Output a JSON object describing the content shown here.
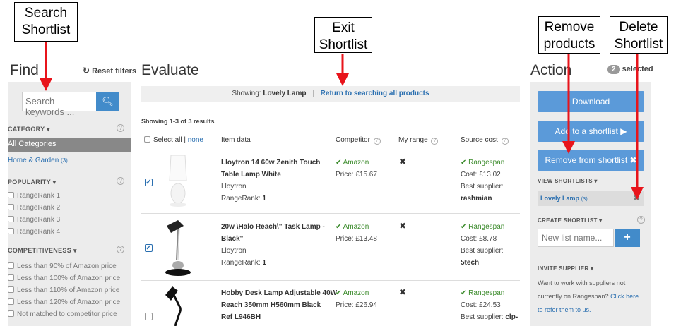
{
  "callouts": {
    "search": [
      "Search",
      "Shortlist"
    ],
    "exit": [
      "Exit",
      "Shortlist"
    ],
    "remove": [
      "Remove",
      "products"
    ],
    "delete": [
      "Delete",
      "Shortlist"
    ],
    "arrow_color": "#e8141b"
  },
  "find": {
    "heading": "Find",
    "reset_label": "Reset filters",
    "search_placeholder": "Search keywords ...",
    "category_title": "CATEGORY",
    "all_categories": "All Categories",
    "home_garden": "Home & Garden",
    "home_garden_count": "(3)",
    "popularity_title": "POPULARITY",
    "popularity": [
      "RangeRank 1",
      "RangeRank 2",
      "RangeRank 3",
      "RangeRank 4"
    ],
    "competitiveness_title": "COMPETITIVENESS",
    "competitiveness": [
      "Less than 90% of Amazon price",
      "Less than 100% of Amazon price",
      "Less than 110% of Amazon price",
      "Less than 120% of Amazon price",
      "Not matched to competitor price"
    ]
  },
  "evaluate": {
    "heading": "Evaluate",
    "showing_label": "Showing:",
    "showing_value": "Lovely Lamp",
    "return_link": "Return to searching all products",
    "results_count": "Showing 1-3 of 3 results",
    "select_all": "Select all",
    "none": "none",
    "columns": [
      "Item data",
      "Competitor",
      "My range",
      "Source cost"
    ],
    "rows": [
      {
        "title_1": "Lloytron 14 60w Zenith Touch",
        "title_2": "Table Lamp White",
        "brand": "Lloytron",
        "rank_label": "RangeRank:",
        "rank": "1",
        "competitor": "Amazon",
        "price": "Price: £15.67",
        "my_range": "✖",
        "source": "Rangespan",
        "cost": "Cost: £13.02",
        "supplier_label": "Best supplier:",
        "supplier": "rashmian",
        "checked": true
      },
      {
        "title_1": "20w \\Halo Reach\\\" Task Lamp -",
        "title_2": "Black\"",
        "brand": "Lloytron",
        "rank_label": "RangeRank:",
        "rank": "1",
        "competitor": "Amazon",
        "price": "Price: £13.48",
        "my_range": "✖",
        "source": "Rangespan",
        "cost": "Cost: £8.78",
        "supplier_label": "Best supplier:",
        "supplier": "5tech",
        "checked": true
      },
      {
        "title_1": "Hobby Desk Lamp Adjustable 40W",
        "title_2": "Reach 350mm H560mm Black",
        "title_3": "Ref L946BH",
        "competitor": "Amazon",
        "price": "Price: £26.94",
        "my_range": "✖",
        "source": "Rangespan",
        "cost": "Cost: £24.53",
        "supplier_label": "Best supplier:",
        "supplier": "clp-",
        "checked": false
      }
    ]
  },
  "action": {
    "heading": "Action",
    "selected_count": "2",
    "selected_label": "selected",
    "download": "Download",
    "add_shortlist": "Add to a shortlist ▶",
    "remove_shortlist": "Remove from shortlist ✖",
    "view_shortlists": "VIEW SHORTLISTS",
    "shortlist_name": "Lovely Lamp",
    "shortlist_count": "(3)",
    "create_shortlist": "CREATE SHORTLIST",
    "new_list_placeholder": "New list name...",
    "invite_title": "INVITE SUPPLIER",
    "invite_text_1": "Want to work with suppliers not",
    "invite_text_2": "currently on Rangespan?",
    "invite_link_1": "Click here",
    "invite_link_2": "to refer them to us."
  }
}
